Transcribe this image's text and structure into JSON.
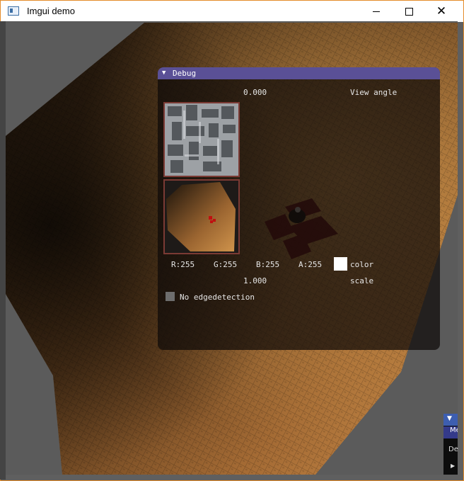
{
  "window": {
    "title": "Imgui demo",
    "accent": "#e48c2a"
  },
  "debug": {
    "title": "Debug",
    "title_color": "#5a5096",
    "angle_value": "0.000",
    "angle_label": "View angle",
    "rgba": [
      "R:255",
      "G:255",
      "B:255",
      "A:255"
    ],
    "color_label": "color",
    "color_value": "#ffffff",
    "scale_value": "1.000",
    "scale_label": "scale",
    "edge_label": "No edgedetection",
    "edge_checked": false
  },
  "mini_window": {
    "tab_label": "Me",
    "text": "De"
  },
  "icons": [
    "app-window-icon",
    "minimize-icon",
    "maximize-icon",
    "close-icon",
    "collapse-triangle-icon",
    "expand-triangle-icon"
  ]
}
